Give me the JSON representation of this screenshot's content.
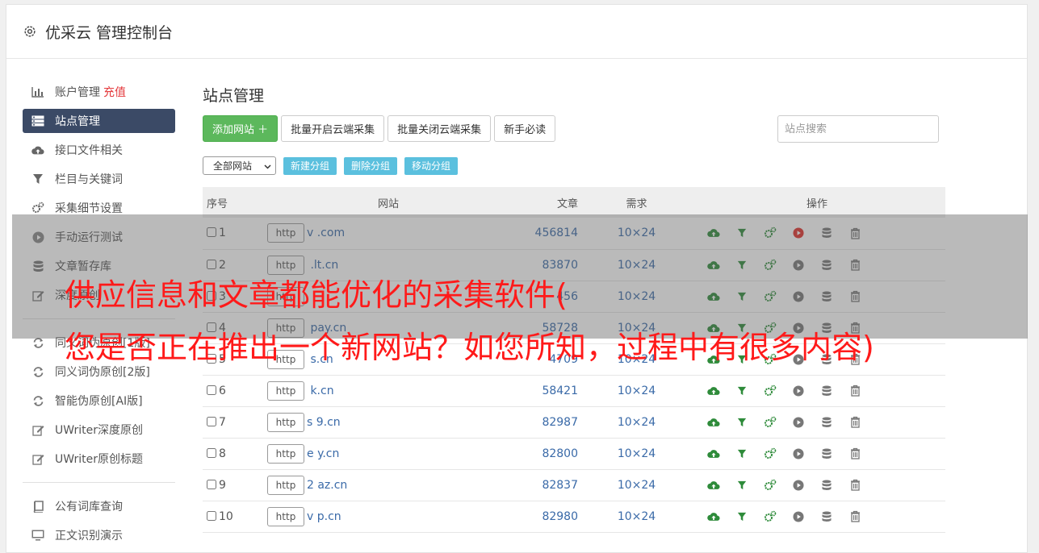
{
  "header": {
    "title": "优采云 管理控制台"
  },
  "sidebar": {
    "group1": [
      {
        "label": "账户管理",
        "extra": "充值",
        "icon": "bar-chart-icon"
      },
      {
        "label": "站点管理",
        "icon": "server-icon",
        "active": true
      },
      {
        "label": "接口文件相关",
        "icon": "cloud-upload-icon"
      },
      {
        "label": "栏目与关键词",
        "icon": "filter-icon"
      },
      {
        "label": "采集细节设置",
        "icon": "cogs-icon"
      },
      {
        "label": "手动运行测试",
        "icon": "play-circle-icon"
      },
      {
        "label": "文章暂存库",
        "icon": "database-icon"
      },
      {
        "label": "深度原创",
        "icon": "edit-icon"
      }
    ],
    "group2": [
      {
        "label": "同义词伪原创[1版]",
        "icon": "refresh-icon"
      },
      {
        "label": "同义词伪原创[2版]",
        "icon": "refresh-icon"
      },
      {
        "label": "智能伪原创[AI版]",
        "icon": "refresh-icon"
      },
      {
        "label": "UWriter深度原创",
        "icon": "edit-icon"
      },
      {
        "label": "UWriter原创标题",
        "icon": "edit-icon"
      }
    ],
    "group3": [
      {
        "label": "公有词库查询",
        "icon": "book-icon"
      },
      {
        "label": "正文识别演示",
        "icon": "monitor-icon"
      }
    ]
  },
  "main": {
    "title": "站点管理",
    "toolbar": {
      "add_site": "添加网站 ＋",
      "batch_open": "批量开启云端采集",
      "batch_close": "批量关闭云端采集",
      "guide": "新手必读"
    },
    "search_placeholder": "站点搜索",
    "filter": {
      "selected": "全部网站",
      "new_group": "新建分组",
      "delete_group": "删除分组",
      "move_group": "移动分组"
    },
    "table": {
      "headers": {
        "no": "序号",
        "site": "网站",
        "articles": "文章",
        "demand": "需求",
        "ops": "操作"
      },
      "http_label": "http",
      "rows": [
        {
          "no": "1",
          "domain": "v          .com",
          "articles": "456814",
          "demand": "10×24",
          "run_active": true
        },
        {
          "no": "2",
          "domain": "      .lt.cn",
          "articles": "83870",
          "demand": "10×24"
        },
        {
          "no": "3",
          "domain": "",
          "articles": "456",
          "demand": "10×24"
        },
        {
          "no": "4",
          "domain": "      pay.cn",
          "articles": "58728",
          "demand": "10×24"
        },
        {
          "no": "5",
          "domain": "      s.cn",
          "articles": "4709",
          "demand": "10×24"
        },
        {
          "no": "6",
          "domain": "      k.cn",
          "articles": "58421",
          "demand": "10×24"
        },
        {
          "no": "7",
          "domain": "s    9.cn",
          "articles": "82987",
          "demand": "10×24"
        },
        {
          "no": "8",
          "domain": "e     y.cn",
          "articles": "82800",
          "demand": "10×24"
        },
        {
          "no": "9",
          "domain": "2     az.cn",
          "articles": "82837",
          "demand": "10×24"
        },
        {
          "no": "10",
          "domain": "v     p.cn",
          "articles": "82980",
          "demand": "10×24"
        }
      ]
    }
  },
  "overlay": {
    "line1": "供应信息和文章都能优化的采集软件(",
    "line2": "您是否正在推出一个新网站？如您所知，过程中有很多内容)"
  },
  "colors": {
    "accent_green": "#5cb85c",
    "info_blue": "#5bc0de",
    "sidebar_active": "#3b4a66",
    "link_blue": "#3a6aa8",
    "overlay_red": "#ff1a1a"
  }
}
